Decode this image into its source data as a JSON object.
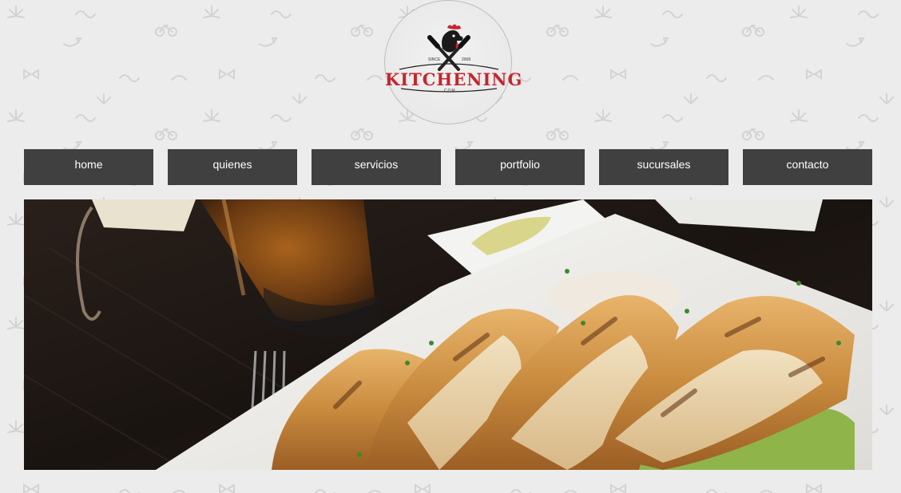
{
  "logo": {
    "brand": "KITCHENING",
    "since": "SINCE",
    "year": "2008",
    "domain": ".COM",
    "accent_color": "#c4262e"
  },
  "nav": {
    "items": [
      {
        "label": "home"
      },
      {
        "label": "quienes"
      },
      {
        "label": "servicios"
      },
      {
        "label": "portfolio"
      },
      {
        "label": "sucursales"
      },
      {
        "label": "contacto"
      }
    ],
    "background_color": "#404040",
    "text_color": "#ffffff"
  },
  "hero": {
    "image_alt": "food photo"
  },
  "colors": {
    "page_background": "#ececec"
  }
}
